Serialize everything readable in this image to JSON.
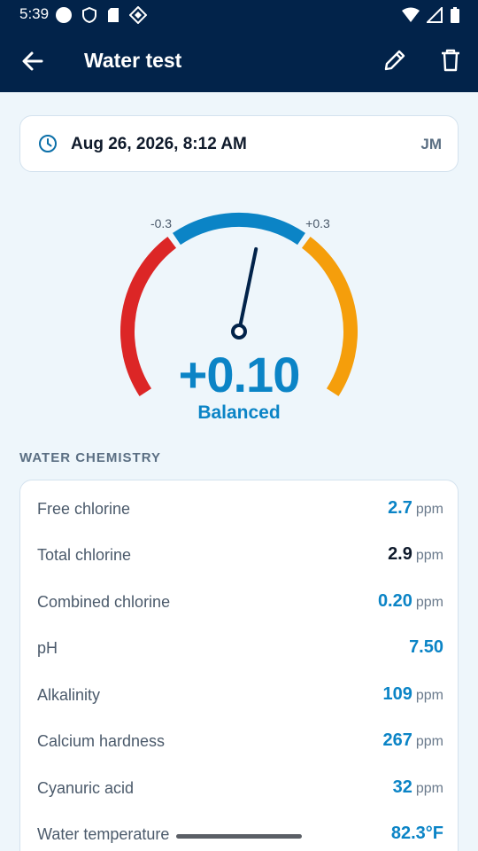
{
  "status_bar": {
    "time": "5:39"
  },
  "app_bar": {
    "title": "Water test"
  },
  "date_card": {
    "datetime": "Aug 26, 2026, 8:12 AM",
    "initials": "JM"
  },
  "gauge": {
    "value": "+0.10",
    "status": "Balanced",
    "min_label": "-0.3",
    "max_label": "+0.3",
    "reading": 0.1,
    "colors": {
      "low": "#dc2626",
      "ideal": "#0b84c6",
      "high": "#f59e0b"
    }
  },
  "section": {
    "title": "WATER CHEMISTRY"
  },
  "chemistry": [
    {
      "label": "Free chlorine",
      "value": "2.7",
      "unit": "ppm"
    },
    {
      "label": "Total chlorine",
      "value": "2.9",
      "unit": "ppm"
    },
    {
      "label": "Combined chlorine",
      "value": "0.20",
      "unit": "ppm"
    },
    {
      "label": "pH",
      "value": "7.50",
      "unit": ""
    },
    {
      "label": "Alkalinity",
      "value": "109",
      "unit": "ppm"
    },
    {
      "label": "Calcium hardness",
      "value": "267",
      "unit": "ppm"
    },
    {
      "label": "Cyanuric acid",
      "value": "32",
      "unit": "ppm"
    },
    {
      "label": "Water temperature",
      "value": "82.3°F",
      "unit": ""
    }
  ]
}
